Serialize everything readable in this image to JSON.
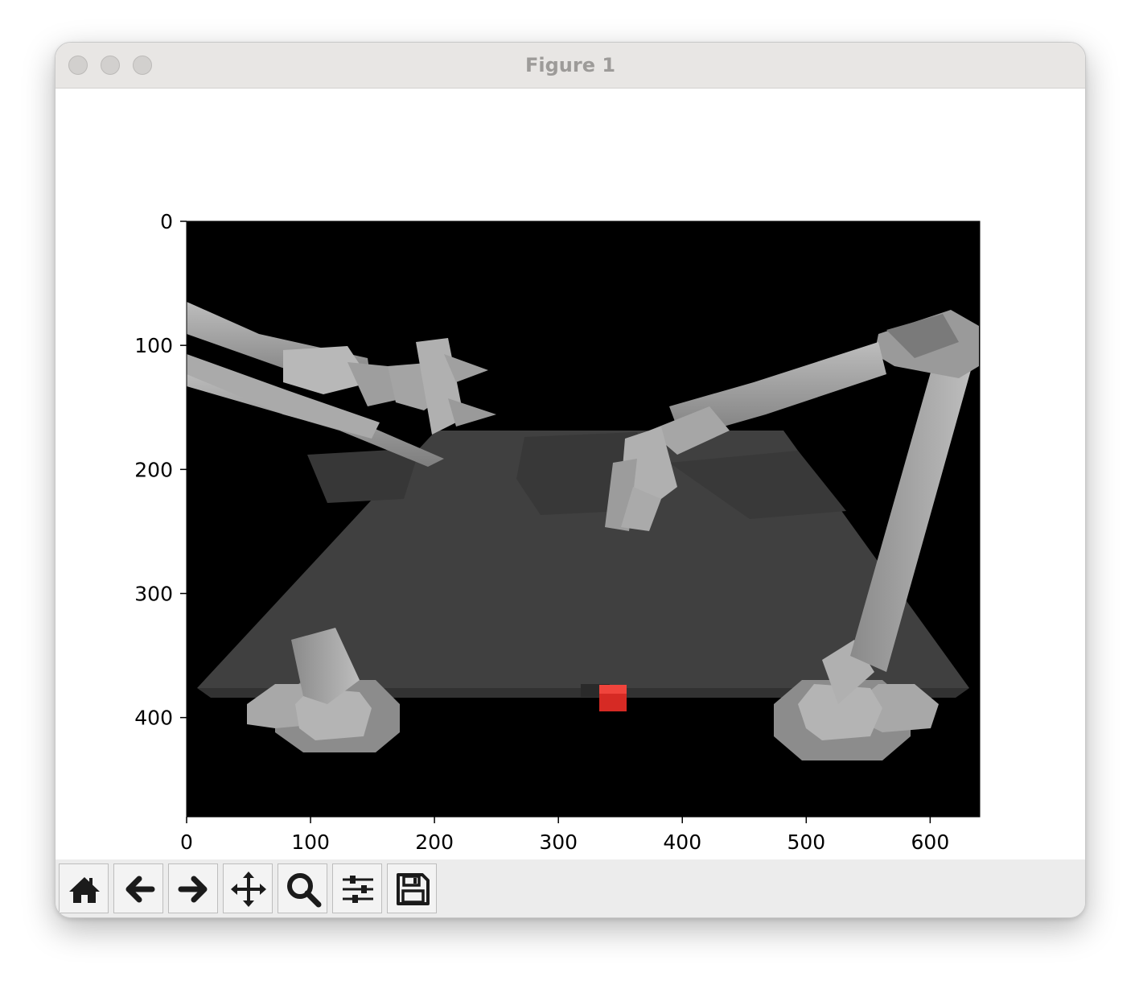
{
  "window": {
    "title": "Figure 1"
  },
  "toolbar": {
    "buttons": [
      {
        "name": "home",
        "icon": "home-icon"
      },
      {
        "name": "back",
        "icon": "arrow-left-icon"
      },
      {
        "name": "forward",
        "icon": "arrow-right-icon"
      },
      {
        "name": "pan",
        "icon": "move-icon"
      },
      {
        "name": "zoom",
        "icon": "magnifier-icon"
      },
      {
        "name": "configure-subplots",
        "icon": "sliders-icon"
      },
      {
        "name": "save",
        "icon": "floppy-disk-icon"
      }
    ]
  },
  "plot": {
    "type": "image",
    "image_width": 640,
    "image_height": 480,
    "xlim": [
      0,
      640
    ],
    "ylim_inverted": [
      480,
      0
    ],
    "xticks": [
      "0",
      "100",
      "200",
      "300",
      "400",
      "500",
      "600"
    ],
    "yticks": [
      "0",
      "100",
      "200",
      "300",
      "400"
    ],
    "colors": {
      "background": "#000000",
      "table": "#404040",
      "robot": "#9a9a9a",
      "cube": "#e8312a"
    }
  }
}
